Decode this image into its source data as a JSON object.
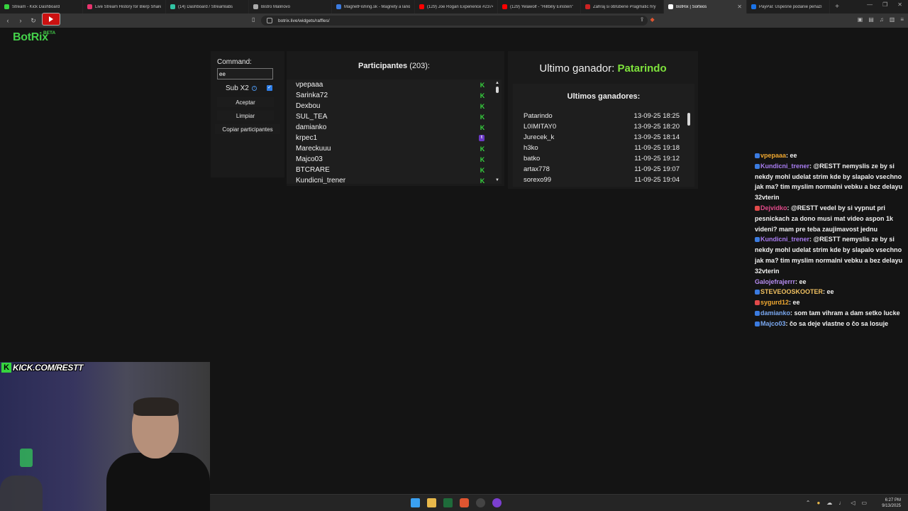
{
  "browser": {
    "tabs": [
      {
        "label": "Stream - Kick Dashboard",
        "icon": "kick-icon",
        "color": "#36d43e",
        "active": false
      },
      {
        "label": "Live Stream History for Blerp Share",
        "icon": "blerp-icon",
        "color": "#e8336d",
        "active": false
      },
      {
        "label": "(14) Dashboard / Streamlabs",
        "icon": "streamlabs-icon",
        "color": "#31c3a2",
        "active": false
      },
      {
        "label": "Bistro Malinovo",
        "icon": "globe-icon",
        "color": "#aaaaaa",
        "active": false
      },
      {
        "label": "MagnetFishing.sk - Magnety a lano",
        "icon": "shop-icon",
        "color": "#3b7be0",
        "active": false
      },
      {
        "label": "(129) Joe Rogan Experience #2374",
        "icon": "youtube-icon",
        "color": "#ff0000",
        "active": false
      },
      {
        "label": "(129) Yelawolf - \"Hillbilly Einstein\"",
        "icon": "youtube-icon",
        "color": "#ff0000",
        "active": false
      },
      {
        "label": "Zahraj si obľúbené Pragmatic hry",
        "icon": "casino-icon",
        "color": "#cc2222",
        "active": false
      },
      {
        "label": "BotRix | Sorteos",
        "icon": "botrix-icon",
        "color": "#ffffff",
        "active": true
      },
      {
        "label": "PayPal: Úspešné podanie peňazí",
        "icon": "paypal-icon",
        "color": "#1a73e8",
        "active": false
      }
    ],
    "url": "botrix.live/widgets/raffles/"
  },
  "header": {
    "logo": "BotRix",
    "badge": "BETA"
  },
  "controls": {
    "command_label": "Command:",
    "command_value": "ee",
    "sub_label": "Sub X2",
    "sub_checked": true,
    "accept_label": "Aceptar",
    "clear_label": "Limpiar",
    "copy_label": "Copiar participantes"
  },
  "participants": {
    "title": "Participantes",
    "count": "(203):",
    "rows": [
      {
        "name": "vpepaaa",
        "platform": "kick"
      },
      {
        "name": "Sarinka72",
        "platform": "kick"
      },
      {
        "name": "Dexbou",
        "platform": "kick"
      },
      {
        "name": "SUL_TEA",
        "platform": "kick"
      },
      {
        "name": "damianko",
        "platform": "kick"
      },
      {
        "name": "krpec1",
        "platform": "twitch"
      },
      {
        "name": "Mareckuuu",
        "platform": "kick"
      },
      {
        "name": "Majco03",
        "platform": "kick"
      },
      {
        "name": "BTCRARE",
        "platform": "kick"
      },
      {
        "name": "Kundicni_trener",
        "platform": "kick"
      }
    ],
    "kick_glyph": "K",
    "twitch_glyph": "t"
  },
  "winner": {
    "label": "Ultimo ganador:",
    "name": "Patarindo",
    "list_title": "Ultimos ganadores:",
    "rows": [
      {
        "name": "Patarindo",
        "time": "13-09-25 18:25"
      },
      {
        "name": "L0IMITAY0",
        "time": "13-09-25 18:20"
      },
      {
        "name": "Jurecek_k",
        "time": "13-09-25 18:14"
      },
      {
        "name": "h3ko",
        "time": "11-09-25 19:18"
      },
      {
        "name": "batko",
        "time": "11-09-25 19:12"
      },
      {
        "name": "artax778",
        "time": "11-09-25 19:07"
      },
      {
        "name": "sorexo99",
        "time": "11-09-25 19:04"
      }
    ]
  },
  "chat": [
    {
      "user": "vpepaaa",
      "color": "#f0a830",
      "badge": "#3b7be0",
      "text": "ee"
    },
    {
      "user": "Kundicni_trener",
      "color": "#a87cf0",
      "badge": "#3b7be0",
      "text": "@RESTT nemyslis ze by si nekdy mohl udelat strim kde by slapalo vsechno jak ma? tim myslim normalni vebku a bez delayu 32vterin"
    },
    {
      "user": "Dejvidko",
      "color": "#e24a8a",
      "badge": "#e24a4a",
      "text": "@RESTT vedel by si vypnut pri pesnickach za dono musi mat video aspon 1k videni? mam pre teba zaujimavost jednu"
    },
    {
      "user": "Kundicni_trener",
      "color": "#a87cf0",
      "badge": "#3b7be0",
      "text": "@RESTT nemyslis ze by si nekdy mohl udelat strim kde by slapalo vsechno jak ma? tim myslim normalni vebku a bez delayu 32vterin"
    },
    {
      "user": "Galojefrajerrr",
      "color": "#b58cf0",
      "badge": "",
      "text": "ee"
    },
    {
      "user": "STEVEOOSKOOTER",
      "color": "#f0c060",
      "badge": "#3b7be0",
      "text": "ee"
    },
    {
      "user": "sygurd12",
      "color": "#f0a830",
      "badge": "#e24a4a",
      "text": "ee"
    },
    {
      "user": "damianko",
      "color": "#7aa8f0",
      "badge": "#3b7be0",
      "text": "som tam vihram a dam setko lucke"
    },
    {
      "user": "Majco03",
      "color": "#7aa8f0",
      "badge": "#3b7be0",
      "text": "čo sa deje vlastne o čo sa losuje"
    }
  ],
  "overlay": {
    "kick_handle": "KICK.COM/RESTT",
    "kick_letter": "K"
  },
  "taskbar": {
    "time": "6:27 PM",
    "date": "9/13/2025"
  }
}
